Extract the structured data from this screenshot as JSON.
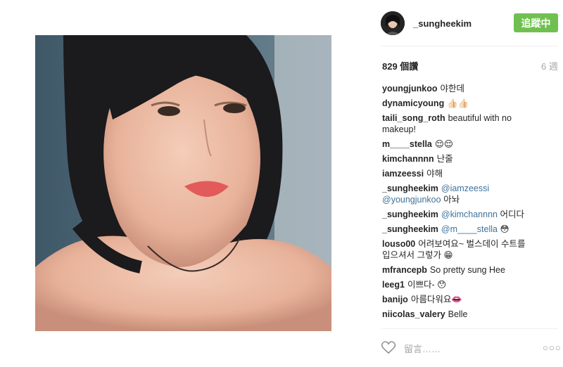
{
  "post": {
    "username": "_sungheekim",
    "follow_label": "追蹤中",
    "views": "829 個讚",
    "time_ago": "6 週"
  },
  "comments": [
    {
      "user": "youngjunkoo",
      "text": "야한데"
    },
    {
      "user": "dynamicyoung",
      "text": "👍🏻👍🏻"
    },
    {
      "user": "taili_song_roth",
      "text": "beautiful with no makeup!"
    },
    {
      "user": "m____stella",
      "text": "😌😌"
    },
    {
      "user": "kimchannnn",
      "text": "난줄"
    },
    {
      "user": "iamzeessi",
      "text": "야해"
    },
    {
      "user": "_sungheekim",
      "mention": "@iamzeessi @youngjunkoo",
      "text": "아놔"
    },
    {
      "user": "_sungheekim",
      "mention": "@kimchannnn",
      "text": "어디다"
    },
    {
      "user": "_sungheekim",
      "mention": "@m____stella",
      "text": "😳"
    },
    {
      "user": "louso00",
      "text": "어려보여요~ 벌스데이 수트를 입으셔서 그렇가 😁"
    },
    {
      "user": "mfrancepb",
      "text": "So pretty sung Hee"
    },
    {
      "user": "leeg1",
      "text": "이쁘다- 😯"
    },
    {
      "user": "banijo",
      "text": "아름다워요👄"
    },
    {
      "user": "niicolas_valery",
      "text": "Belle"
    }
  ],
  "footer": {
    "comment_placeholder": "留言……",
    "like_icon": "heart-outline-icon",
    "more_icon": "ellipsis-icon"
  },
  "colors": {
    "follow_button": "#70c050",
    "mention": "#3f729b",
    "muted": "#a5a7aa"
  }
}
